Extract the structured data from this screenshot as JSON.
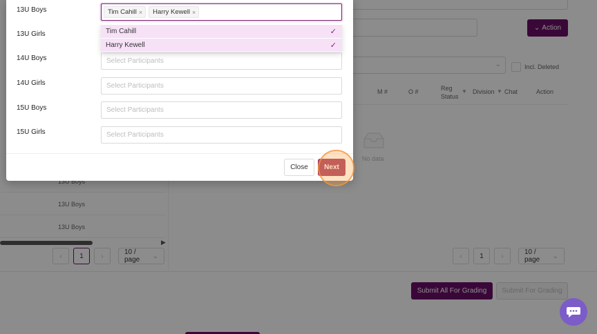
{
  "background": {
    "action_label": "Action",
    "incl_deleted_label": "Incl. Deleted",
    "table_headers": [
      "M #",
      "O #",
      "Reg Status",
      "Division",
      "Chat",
      "Action"
    ],
    "no_data_label": "No data",
    "left_rows": [
      "13U Boys",
      "13U Boys",
      "13U Boys"
    ],
    "left_pager": {
      "current_page": "1",
      "page_size": "10 / page"
    },
    "right_pager": {
      "current_page": "1",
      "page_size": "10 / page"
    },
    "submit_all_label": "Submit All For Grading",
    "submit_one_label": "Submit For Grading"
  },
  "modal": {
    "rows": [
      {
        "label": "13U Boys",
        "placeholder": "Select Participants"
      },
      {
        "label": "13U Girls",
        "placeholder": "Select Participants"
      },
      {
        "label": "14U Boys",
        "placeholder": "Select Participants"
      },
      {
        "label": "14U Girls",
        "placeholder": "Select Participants"
      },
      {
        "label": "15U Boys",
        "placeholder": "Select Participants"
      },
      {
        "label": "15U Girls",
        "placeholder": "Select Participants"
      }
    ],
    "selected_tags": [
      "Tim Cahill",
      "Harry Kewell"
    ],
    "dropdown_options": [
      {
        "label": "Tim Cahill",
        "selected": true
      },
      {
        "label": "Harry Kewell",
        "selected": true
      }
    ],
    "close_label": "Close",
    "next_label": "Next"
  },
  "colors": {
    "primary": "#6b0f66",
    "next": "#a3375e",
    "option_bg": "#f7e1f7"
  }
}
